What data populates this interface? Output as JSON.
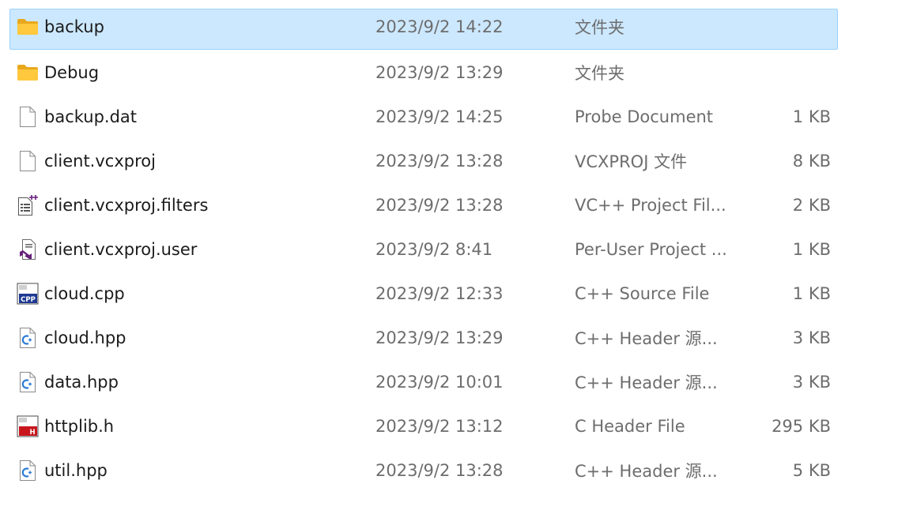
{
  "files": [
    {
      "name": "backup",
      "date": "2023/9/2 14:22",
      "type": "文件夹",
      "size": "",
      "icon": "folder-icon",
      "selected": true
    },
    {
      "name": "Debug",
      "date": "2023/9/2 13:29",
      "type": "文件夹",
      "size": "",
      "icon": "folder-icon",
      "selected": false
    },
    {
      "name": "backup.dat",
      "date": "2023/9/2 14:25",
      "type": "Probe Document",
      "size": "1 KB",
      "icon": "blank-file-icon",
      "selected": false
    },
    {
      "name": "client.vcxproj",
      "date": "2023/9/2 13:28",
      "type": "VCXPROJ 文件",
      "size": "8 KB",
      "icon": "blank-file-icon",
      "selected": false
    },
    {
      "name": "client.vcxproj.filters",
      "date": "2023/9/2 13:28",
      "type": "VC++ Project Fil...",
      "size": "2 KB",
      "icon": "vc-filters-file-icon",
      "selected": false
    },
    {
      "name": "client.vcxproj.user",
      "date": "2023/9/2 8:41",
      "type": "Per-User Project ...",
      "size": "1 KB",
      "icon": "visual-studio-file-icon",
      "selected": false
    },
    {
      "name": "cloud.cpp",
      "date": "2023/9/2 12:33",
      "type": "C++ Source File",
      "size": "1 KB",
      "icon": "cpp-file-icon",
      "selected": false
    },
    {
      "name": "cloud.hpp",
      "date": "2023/9/2 13:29",
      "type": "C++ Header 源...",
      "size": "3 KB",
      "icon": "cpp-header-file-icon",
      "selected": false
    },
    {
      "name": "data.hpp",
      "date": "2023/9/2 10:01",
      "type": "C++ Header 源...",
      "size": "3 KB",
      "icon": "cpp-header-file-icon",
      "selected": false
    },
    {
      "name": "httplib.h",
      "date": "2023/9/2 13:12",
      "type": "C Header File",
      "size": "295 KB",
      "icon": "c-header-file-icon",
      "selected": false
    },
    {
      "name": "util.hpp",
      "date": "2023/9/2 13:28",
      "type": "C++ Header 源...",
      "size": "5 KB",
      "icon": "cpp-header-file-icon",
      "selected": false
    }
  ],
  "colors": {
    "selection_bg": "#cce8ff",
    "selection_border": "#99d1ff",
    "folder": "#ffc83d",
    "secondary_text": "#6d6d6d"
  },
  "icon_labels": {
    "cpp": "CPP",
    "header": "H"
  }
}
